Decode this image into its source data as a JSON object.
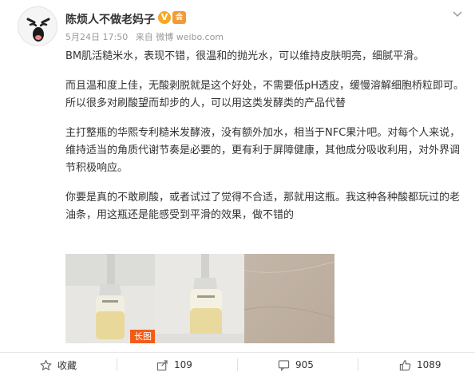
{
  "post": {
    "author": "陈烦人不做老妈子",
    "verified_badge": "V",
    "vip_badge": "会",
    "date": "5月24日 17:50",
    "source": "来自 微博 weibo.com",
    "paragraphs": [
      "BM肌活糙米水，表现不错，很温和的抛光水，可以维持皮肤明亮，细腻平滑。",
      "而且温和度上佳，无酸剥脱就是这个好处，不需要低pH透皮，缓慢溶解细胞桥粒即可。所以很多对刷酸望而却步的人，可以用这类发酵类的产品代替",
      "主打整瓶的华熙专利糙米发酵液，没有额外加水，相当于NFC果汁吧。对每个人来说，维持适当的角质代谢节奏是必要的，更有利于屏障健康，其他成分吸收利用，对外界调节积极响应。",
      "你要是真的不敢刷酸，或者试过了觉得不合适，那就用这瓶。我这种各种酸都玩过的老油条，用这瓶还是能感受到平滑的效果，做不错的"
    ],
    "images": {
      "long_image_tag": "长图"
    }
  },
  "toolbar": {
    "favorite_label": "收藏",
    "share_count": "109",
    "comment_count": "905",
    "like_count": "1089"
  },
  "colors": {
    "accent_orange": "#f25c17",
    "vip_orange": "#f29b38",
    "meta_gray": "#999999"
  },
  "icons": {
    "more": "chevron-down-icon",
    "favorite": "star-icon",
    "share": "share-icon",
    "comment": "comment-icon",
    "like": "thumbs-up-icon"
  }
}
